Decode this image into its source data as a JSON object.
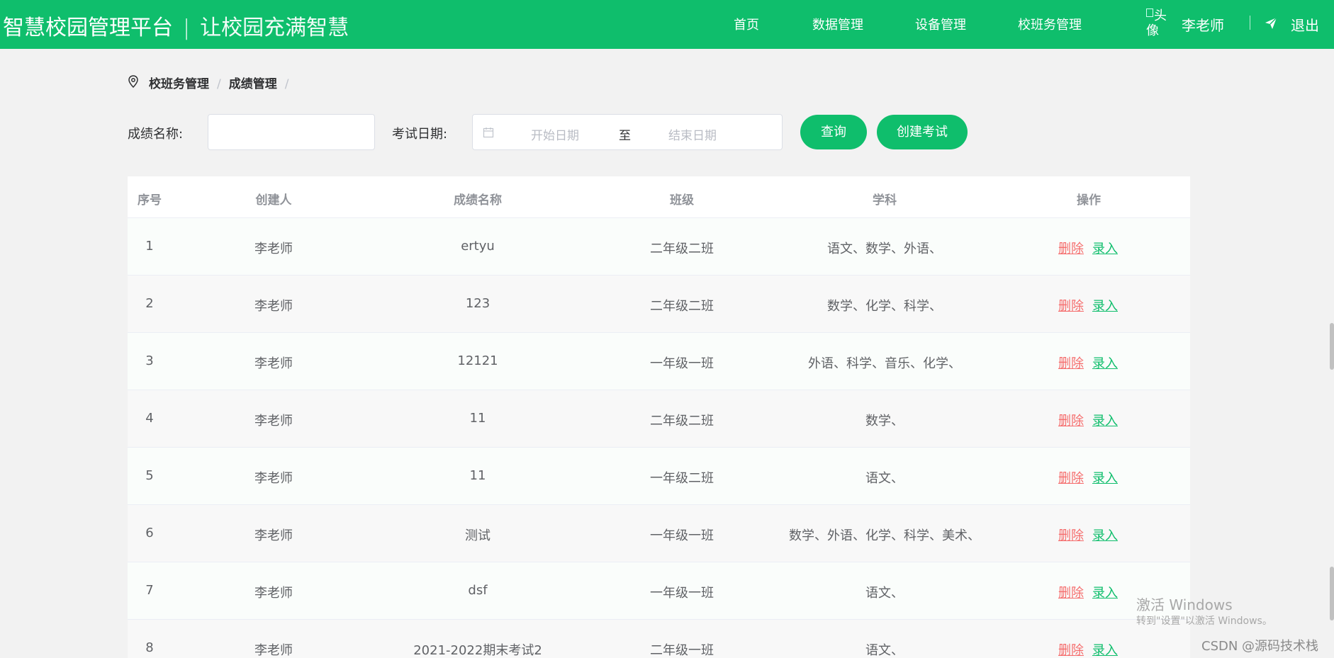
{
  "header": {
    "brand_title": "智慧校园管理平台",
    "brand_sep": "|",
    "brand_slogan": "让校园充满智慧",
    "nav": [
      "首页",
      "数据管理",
      "设备管理",
      "校班务管理"
    ],
    "avatar_alt": "头像",
    "username": "李老师",
    "logout": "退出",
    "bg_color": "#0fbe6c"
  },
  "breadcrumb": {
    "items": [
      "校班务管理",
      "成绩管理"
    ],
    "sep": "/"
  },
  "filter": {
    "name_label": "成绩名称:",
    "name_value": "",
    "date_label": "考试日期:",
    "start_placeholder": "开始日期",
    "range_sep": "至",
    "end_placeholder": "结束日期",
    "query_button": "查询",
    "create_button": "创建考试"
  },
  "table": {
    "headers": [
      "序号",
      "创建人",
      "成绩名称",
      "班级",
      "学科",
      "操作"
    ],
    "rows": [
      {
        "no": "1",
        "creator": "李老师",
        "name": "ertyu",
        "class": "二年级二班",
        "subjects": "语文、数学、外语、"
      },
      {
        "no": "2",
        "creator": "李老师",
        "name": "123",
        "class": "二年级二班",
        "subjects": "数学、化学、科学、"
      },
      {
        "no": "3",
        "creator": "李老师",
        "name": "12121",
        "class": "一年级一班",
        "subjects": "外语、科学、音乐、化学、"
      },
      {
        "no": "4",
        "creator": "李老师",
        "name": "11",
        "class": "二年级二班",
        "subjects": "数学、"
      },
      {
        "no": "5",
        "creator": "李老师",
        "name": "11",
        "class": "一年级二班",
        "subjects": "语文、"
      },
      {
        "no": "6",
        "creator": "李老师",
        "name": "测试",
        "class": "一年级一班",
        "subjects": "数学、外语、化学、科学、美术、"
      },
      {
        "no": "7",
        "creator": "李老师",
        "name": "dsf",
        "class": "一年级一班",
        "subjects": "语文、"
      },
      {
        "no": "8",
        "creator": "李老师",
        "name": "2021-2022期末考试2",
        "class": "二年级一班",
        "subjects": "语文、"
      }
    ],
    "op_delete": "删除",
    "op_entry": "录入"
  },
  "watermark": {
    "line1": "激活 Windows",
    "line2": "转到\"设置\"以激活 Windows。",
    "csdn": "CSDN @源码技术栈"
  }
}
